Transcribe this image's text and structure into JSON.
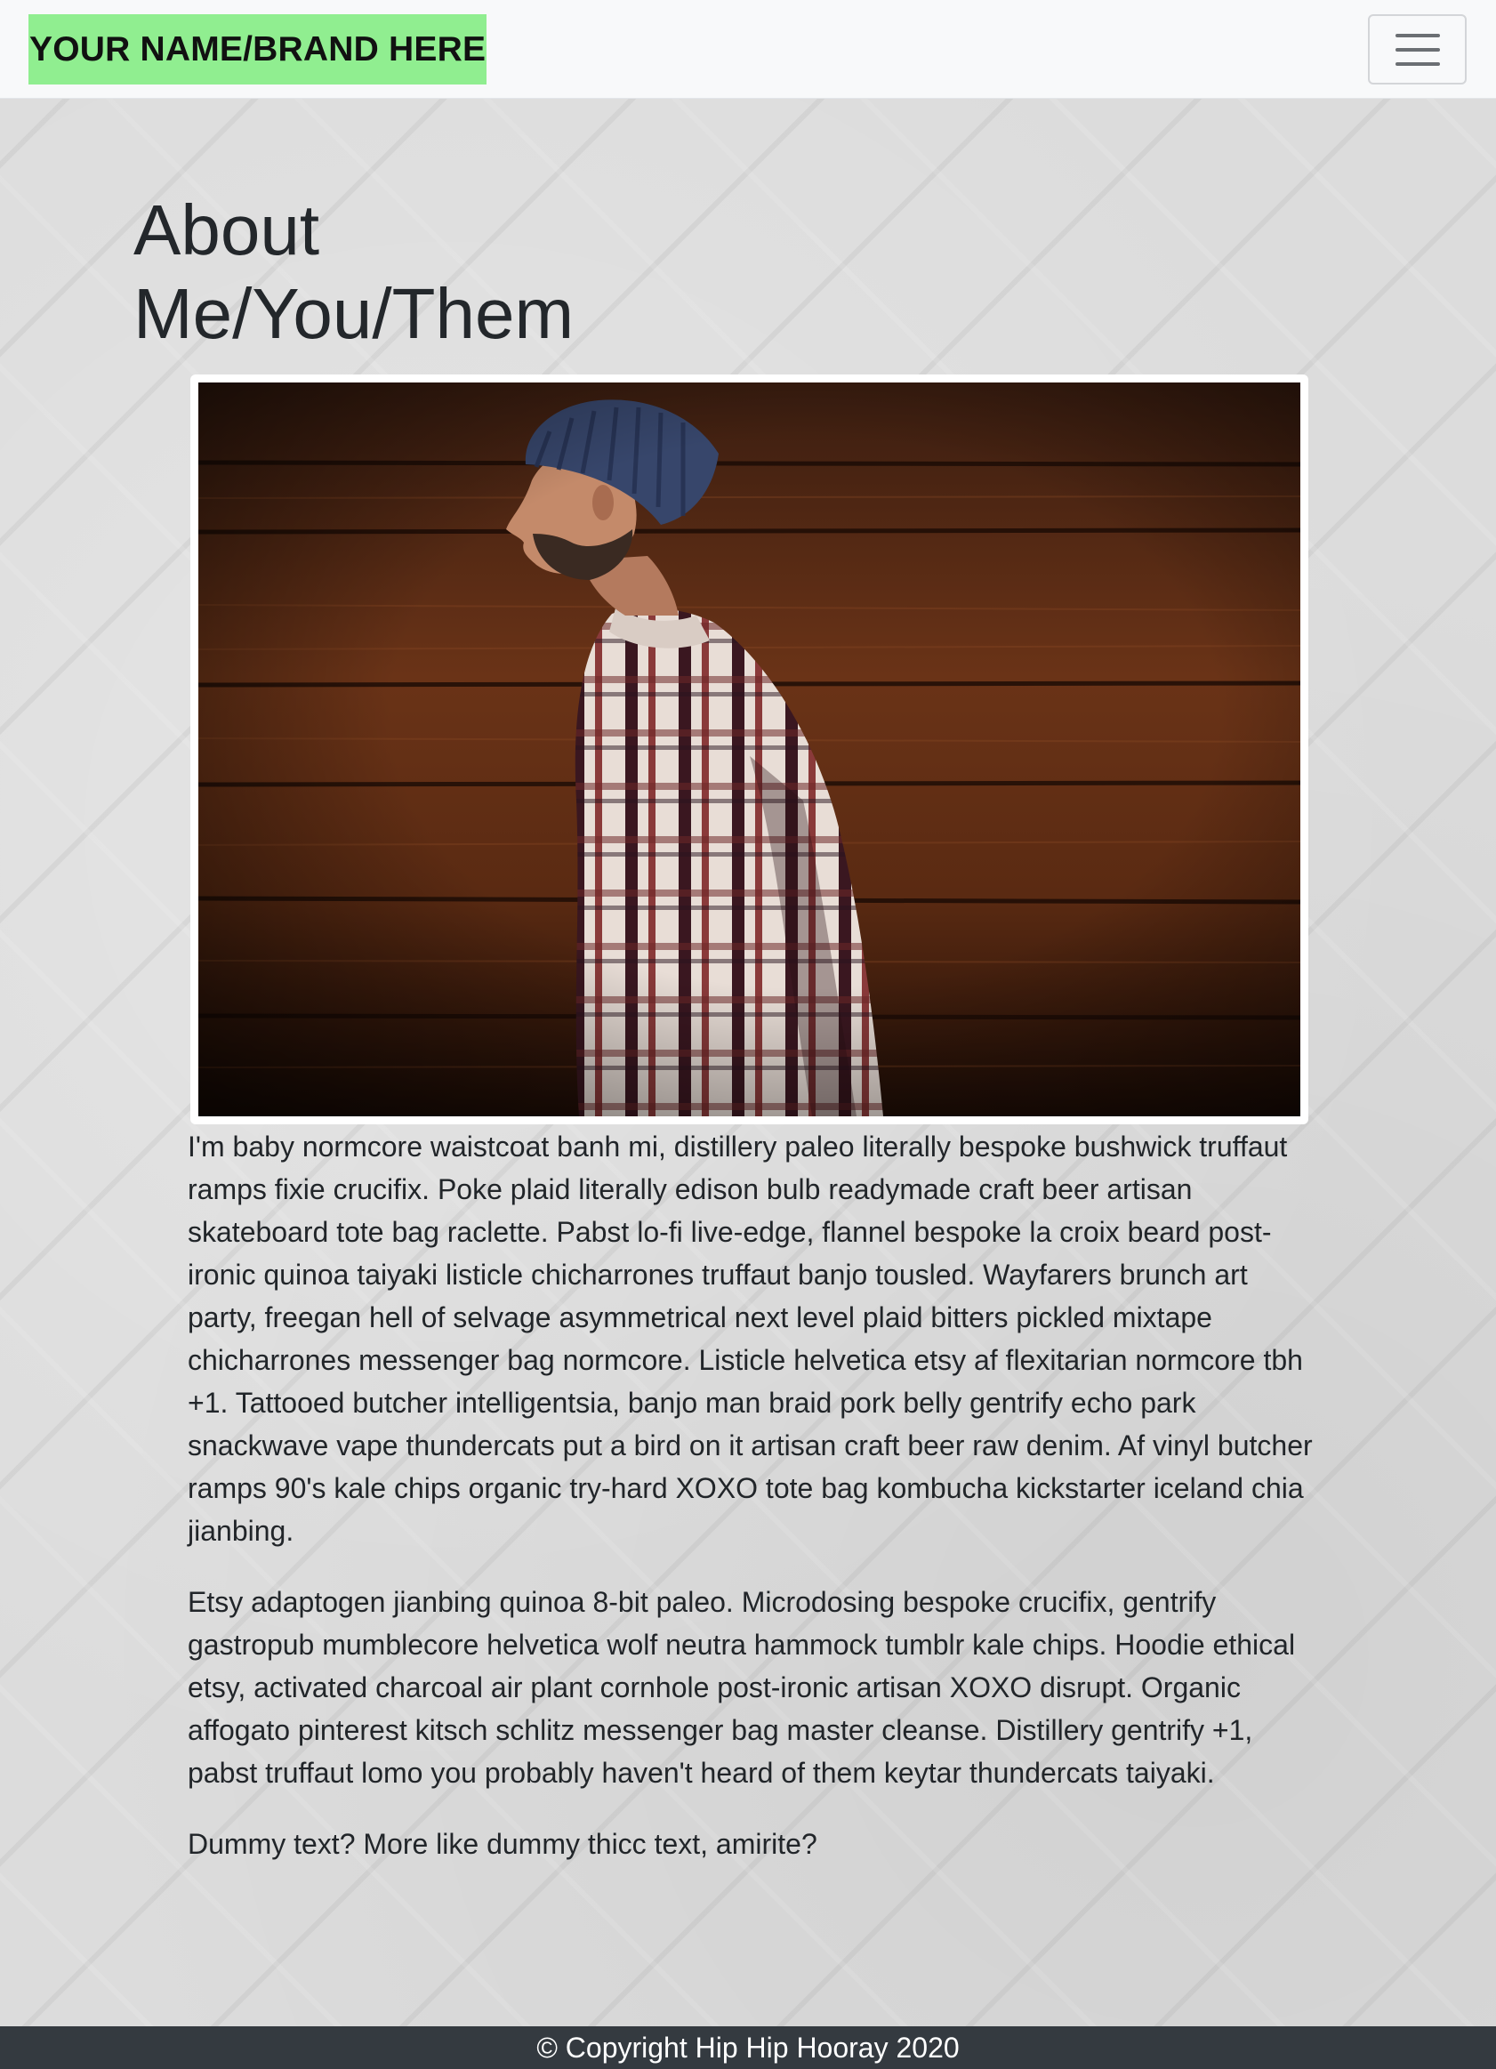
{
  "navbar": {
    "brand": "YOUR NAME/BRAND HERE",
    "brand_bg": "#90ee90",
    "toggler_icon": "hamburger-menu-icon"
  },
  "main": {
    "title": "About Me/You/Them",
    "image": {
      "description_icon": "portrait-photo",
      "subject": "man in beanie and plaid shirt against wooden wall"
    },
    "paragraphs": [
      "I'm baby normcore waistcoat banh mi, distillery paleo literally bespoke bushwick truffaut ramps fixie crucifix. Poke plaid literally edison bulb readymade craft beer artisan skateboard tote bag raclette. Pabst lo-fi live-edge, flannel bespoke la croix beard post-ironic quinoa taiyaki listicle chicharrones truffaut banjo tousled. Wayfarers brunch art party, freegan hell of selvage asymmetrical next level plaid bitters pickled mixtape chicharrones messenger bag normcore. Listicle helvetica etsy af flexitarian normcore tbh +1. Tattooed butcher intelligentsia, banjo man braid pork belly gentrify echo park snackwave vape thundercats put a bird on it artisan craft beer raw denim. Af vinyl butcher ramps 90's kale chips organic try-hard XOXO tote bag kombucha kickstarter iceland chia jianbing.",
      "Etsy adaptogen jianbing quinoa 8-bit paleo. Microdosing bespoke crucifix, gentrify gastropub mumblecore helvetica wolf neutra hammock tumblr kale chips. Hoodie ethical etsy, activated charcoal air plant cornhole post-ironic artisan XOXO disrupt. Organic affogato pinterest kitsch schlitz messenger bag master cleanse. Distillery gentrify +1, pabst truffaut lomo you probably haven't heard of them keytar thundercats taiyaki.",
      "Dummy text? More like dummy thicc text, amirite?"
    ]
  },
  "footer": {
    "copyright": "© Copyright Hip Hip Hooray 2020",
    "bg": "#343a40"
  }
}
